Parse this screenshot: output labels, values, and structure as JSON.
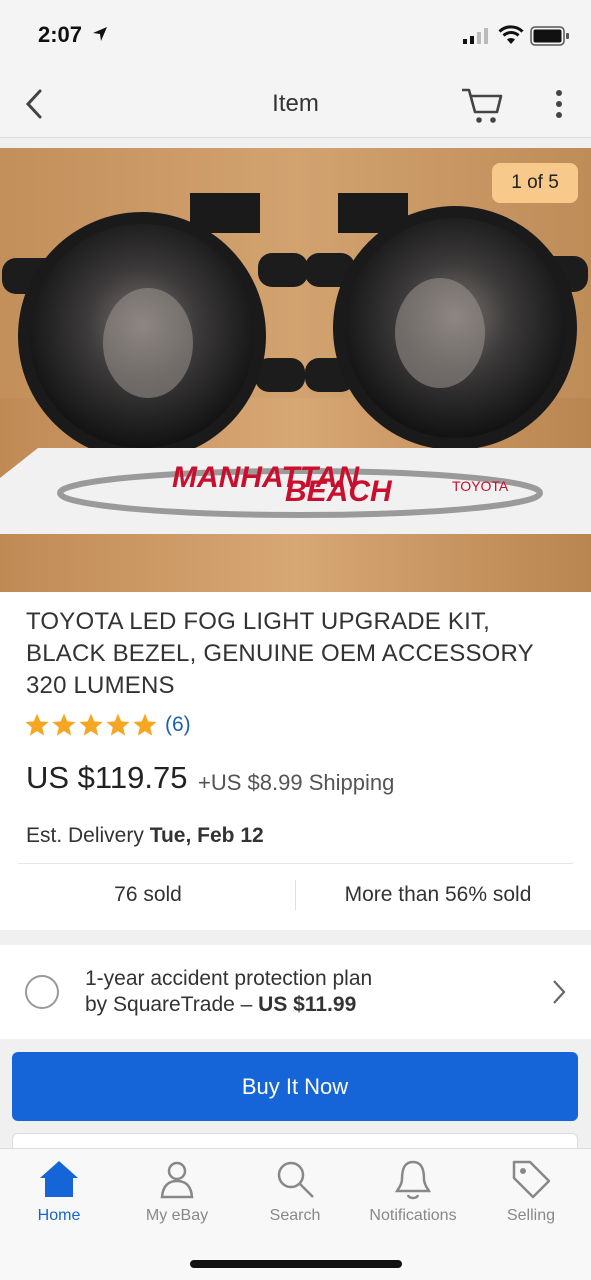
{
  "status_bar": {
    "time": "2:07"
  },
  "nav": {
    "title": "Item"
  },
  "image": {
    "counter": "1 of 5",
    "watermark_line1": "MANHATTAN",
    "watermark_line2": "BEACH",
    "watermark_brand": "TOYOTA"
  },
  "listing": {
    "title": "TOYOTA LED FOG LIGHT UPGRADE KIT, BLACK BEZEL, GENUINE OEM ACCESSORY 320 LUMENS",
    "rating": 5,
    "reviews": "(6)",
    "price": "US $119.75",
    "shipping": "+US $8.99 Shipping",
    "delivery_label": "Est. Delivery",
    "delivery_date": "Tue, Feb 12",
    "sold": "76 sold",
    "sold_pct": "More than 56% sold"
  },
  "protection": {
    "line1": "1-year accident protection plan",
    "line2_prefix": "by SquareTrade – ",
    "line2_price": "US $11.99"
  },
  "buy_button": "Buy It Now",
  "tabs": [
    {
      "label": "Home",
      "icon": "home-icon"
    },
    {
      "label": "My eBay",
      "icon": "person-icon"
    },
    {
      "label": "Search",
      "icon": "search-icon"
    },
    {
      "label": "Notifications",
      "icon": "bell-icon"
    },
    {
      "label": "Selling",
      "icon": "tag-icon"
    }
  ],
  "colors": {
    "accent": "#1565d8",
    "star": "#f5a623",
    "counter_bg": "#f7c98a"
  }
}
